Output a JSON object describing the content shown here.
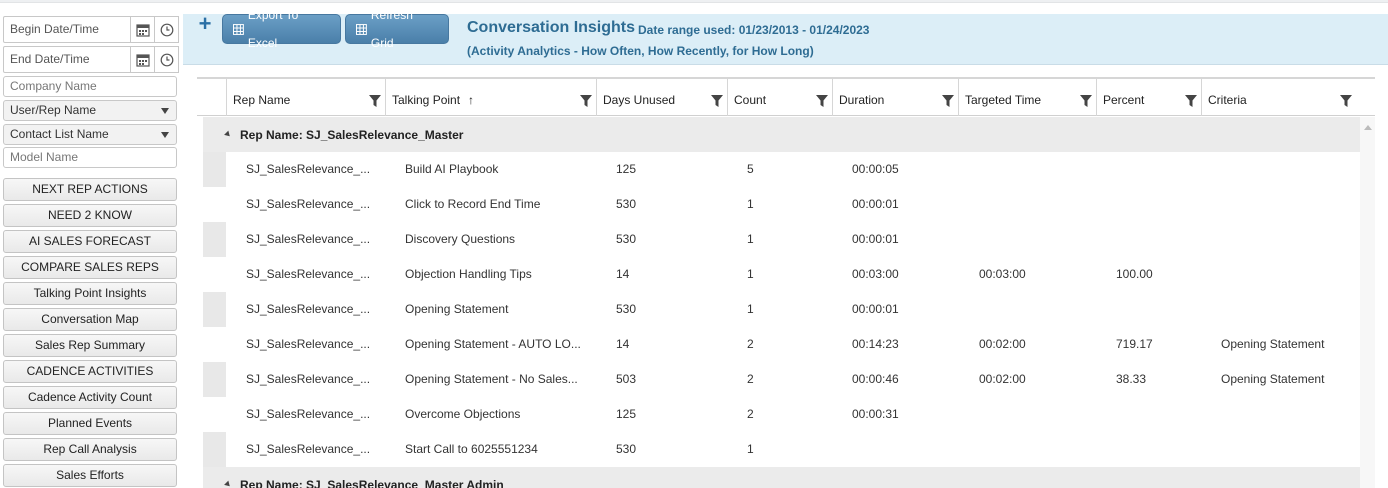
{
  "filters": {
    "begin_date_placeholder": "Begin Date/Time",
    "end_date_placeholder": "End Date/Time",
    "company_placeholder": "Company Name",
    "user_rep_label": "User/Rep Name",
    "contact_list_label": "Contact List Name",
    "model_placeholder": "Model Name"
  },
  "nav": [
    "NEXT REP ACTIONS",
    "NEED 2 KNOW",
    "AI SALES FORECAST",
    "COMPARE SALES REPS",
    "Talking Point Insights",
    "Conversation Map",
    "Sales Rep Summary",
    "CADENCE ACTIVITIES",
    "Cadence Activity Count",
    "Planned Events",
    "Rep Call Analysis",
    "Sales Efforts"
  ],
  "toolbar": {
    "add_label": "+",
    "export_label": "Export To Excel",
    "refresh_label": "Refresh Grid"
  },
  "header": {
    "title": "Conversation Insights",
    "date_range": "Date range used: 01/23/2013 - 01/24/2023",
    "subtitle": "(Activity Analytics - How Often, How Recently, for How Long)"
  },
  "grid": {
    "columns": [
      "Rep Name",
      "Talking Point",
      "Days Unused",
      "Count",
      "Duration",
      "Targeted Time",
      "Percent",
      "Criteria"
    ],
    "sort_indicator": "↑",
    "groups": [
      {
        "label": "Rep Name: SJ_SalesRelevance_Master",
        "rows": [
          [
            "SJ_SalesRelevance_...",
            "Build AI Playbook",
            "125",
            "5",
            "00:00:05",
            "",
            "",
            ""
          ],
          [
            "SJ_SalesRelevance_...",
            "Click to Record End Time",
            "530",
            "1",
            "00:00:01",
            "",
            "",
            ""
          ],
          [
            "SJ_SalesRelevance_...",
            "Discovery Questions",
            "530",
            "1",
            "00:00:01",
            "",
            "",
            ""
          ],
          [
            "SJ_SalesRelevance_...",
            "Objection Handling Tips",
            "14",
            "1",
            "00:03:00",
            "00:03:00",
            "100.00",
            ""
          ],
          [
            "SJ_SalesRelevance_...",
            "Opening Statement",
            "530",
            "1",
            "00:00:01",
            "",
            "",
            ""
          ],
          [
            "SJ_SalesRelevance_...",
            "Opening Statement - AUTO LO...",
            "14",
            "2",
            "00:14:23",
            "00:02:00",
            "719.17",
            "Opening Statement"
          ],
          [
            "SJ_SalesRelevance_...",
            "Opening Statement - No Sales...",
            "503",
            "2",
            "00:00:46",
            "00:02:00",
            "38.33",
            "Opening Statement"
          ],
          [
            "SJ_SalesRelevance_...",
            "Overcome Objections",
            "125",
            "2",
            "00:00:31",
            "",
            "",
            ""
          ],
          [
            "SJ_SalesRelevance_...",
            "Start Call to 6025551234",
            "530",
            "1",
            "",
            "",
            "",
            ""
          ]
        ]
      },
      {
        "label": "Rep Name: SJ_SalesRelevance_Master Admin",
        "rows": []
      }
    ]
  }
}
